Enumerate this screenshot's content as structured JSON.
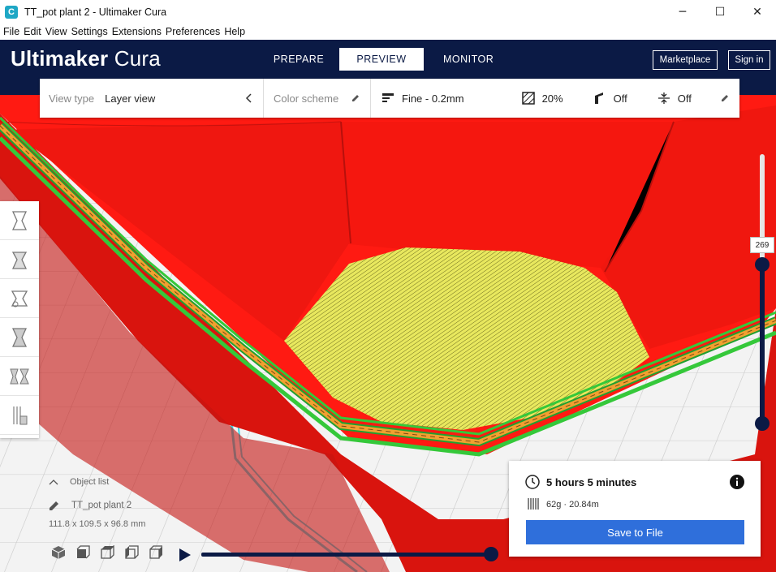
{
  "window": {
    "title": "TT_pot plant 2 - Ultimaker Cura",
    "minimize": "─",
    "maximize": "☐",
    "close": "✕"
  },
  "menu": [
    "File",
    "Edit",
    "View",
    "Settings",
    "Extensions",
    "Preferences",
    "Help"
  ],
  "header": {
    "brand_bold": "Ultimaker",
    "brand_light": "Cura",
    "tabs": [
      "PREPARE",
      "PREVIEW",
      "MONITOR"
    ],
    "active_tab": "PREVIEW",
    "marketplace": "Marketplace",
    "sign_in": "Sign in"
  },
  "view_toolbar": {
    "view_type_label": "View type",
    "view_type_value": "Layer view",
    "color_scheme_label": "Color scheme",
    "profile": "Fine - 0.2mm",
    "infill": "20%",
    "support": "Off",
    "adhesion": "Off"
  },
  "layer_slider": {
    "current_layer": "269",
    "level": 0.58
  },
  "object": {
    "list_label": "Object list",
    "name": "TT_pot plant 2",
    "dimensions": "111.8 x 109.5 x 96.8 mm"
  },
  "print_info": {
    "time": "5 hours 5 minutes",
    "material": "62g · 20.84m",
    "save_button": "Save to File"
  },
  "colors": {
    "header_bg": "#0b1a45",
    "accent_blue": "#2f6fdb",
    "model_red": "#ff1a12",
    "infill_yellow": "#e3e35a",
    "wall_green": "#35c83a",
    "wall_orange": "#f0a030",
    "travel_cyan": "#39d9e6"
  },
  "icons": [
    "cura-logo-icon",
    "chevron-left-icon",
    "pencil-icon",
    "layer-height-icon",
    "infill-icon",
    "support-icon",
    "adhesion-icon",
    "clock-icon",
    "info-icon",
    "filament-icon",
    "play-icon",
    "caret-up-icon"
  ]
}
